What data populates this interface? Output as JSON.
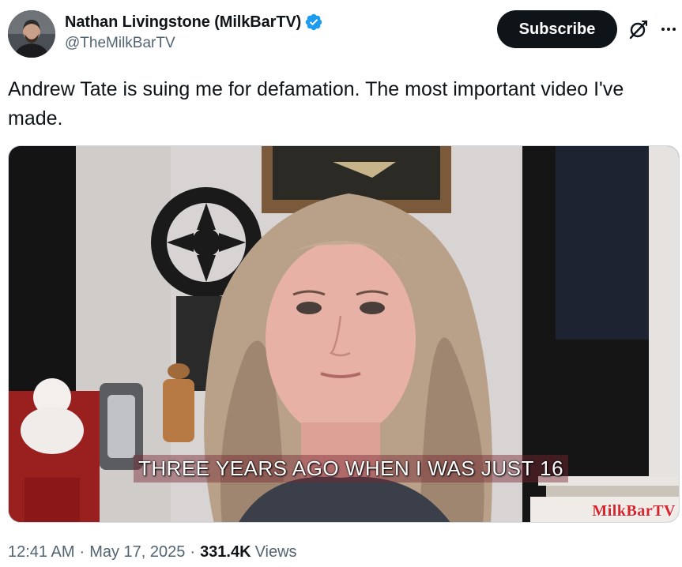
{
  "author": {
    "display_name": "Nathan Livingstone (MilkBarTV)",
    "handle": "@TheMilkBarTV"
  },
  "actions": {
    "subscribe_label": "Subscribe"
  },
  "tweet": {
    "text": "Andrew Tate is suing me for defamation. The most important video I've made."
  },
  "media": {
    "caption": "THREE YEARS AGO WHEN I WAS JUST 16",
    "watermark": "MilkBarTV"
  },
  "meta": {
    "time": "12:41 AM",
    "date": "May 17, 2025",
    "views_count": "331.4K",
    "views_label": "Views",
    "separator": "·"
  },
  "colors": {
    "verified_blue": "#1d9bf0",
    "button_bg": "#0f1419",
    "secondary_text": "#536471"
  },
  "icons": [
    "verified-badge-icon",
    "grok-icon",
    "more-options-icon"
  ]
}
